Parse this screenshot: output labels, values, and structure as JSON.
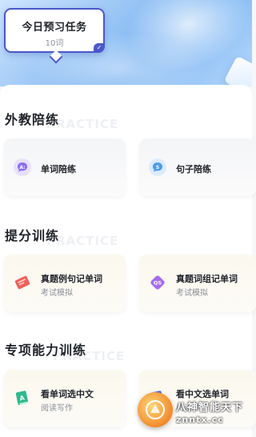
{
  "task_bubble": {
    "title": "今日预习任务",
    "count": "10词"
  },
  "sections": {
    "foreign": {
      "title": "外教陪练",
      "ghost": "PRACTICE",
      "cards": [
        {
          "title": "单词陪练",
          "icon": "bubble-a-icon"
        },
        {
          "title": "句子陪练",
          "icon": "bubble-s-icon"
        }
      ]
    },
    "boost": {
      "title": "提分训练",
      "ghost": "PRACTICE",
      "cards": [
        {
          "title": "真题例句记单词",
          "sub": "考试模拟",
          "icon": "ticket-icon"
        },
        {
          "title": "真题词组记单词",
          "sub": "考试模拟",
          "icon": "qs-diamond-icon"
        }
      ]
    },
    "special": {
      "title": "专项能力训练",
      "ghost": "PRACTICE",
      "cards": [
        {
          "title": "看单词选中文",
          "sub": "阅读写作",
          "icon": "book-a-icon"
        },
        {
          "title": "看中文选单词",
          "sub": "阅读写作",
          "icon": "book-icon"
        }
      ]
    }
  },
  "watermark": {
    "line1": "八神智能天下",
    "line2": "znntx.cc"
  },
  "colors": {
    "bubble_border": "#4a57c9",
    "hero_blue": "#7cb5f2",
    "purple": "#8b6cf0",
    "blue": "#4a9bf0",
    "red": "#f0605a",
    "green": "#2fb98b"
  }
}
